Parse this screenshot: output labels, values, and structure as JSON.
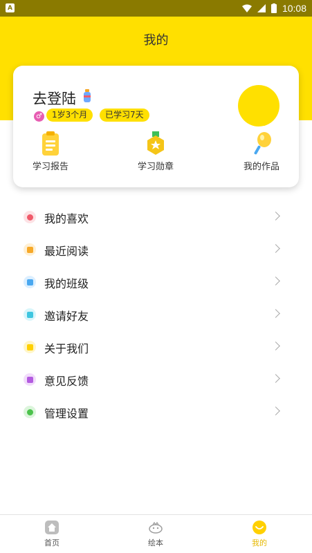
{
  "status_bar": {
    "left_glyph": "A",
    "time": "10:08"
  },
  "header": {
    "title": "我的"
  },
  "profile": {
    "username": "去登陆",
    "gender_glyph": "♂",
    "age_badge": "1岁3个月",
    "study_badge": "已学习7天"
  },
  "card_actions": [
    {
      "label": "学习报告",
      "icon": "clipboard-report-icon"
    },
    {
      "label": "学习勋章",
      "icon": "medal-icon"
    },
    {
      "label": "我的作品",
      "icon": "lollipop-works-icon"
    }
  ],
  "menu": [
    {
      "label": "我的喜欢",
      "icon": "heart-icon",
      "color": "#f05a6a",
      "bg": "#fde2e5"
    },
    {
      "label": "最近阅读",
      "icon": "book-icon",
      "color": "#f7a928",
      "bg": "#fff0d4"
    },
    {
      "label": "我的班级",
      "icon": "house-icon",
      "color": "#4aa8f0",
      "bg": "#dcefff"
    },
    {
      "label": "邀请好友",
      "icon": "invite-icon",
      "color": "#3ec6e0",
      "bg": "#d9f6fb"
    },
    {
      "label": "关于我们",
      "icon": "about-icon",
      "color": "#ffd000",
      "bg": "#fff6c8"
    },
    {
      "label": "意见反馈",
      "icon": "feedback-icon",
      "color": "#b35be0",
      "bg": "#f2ddfb"
    },
    {
      "label": "管理设置",
      "icon": "settings-icon",
      "color": "#4cc24c",
      "bg": "#dcf5dc"
    }
  ],
  "tabbar": {
    "items": [
      {
        "label": "首页",
        "icon": "home-icon"
      },
      {
        "label": "绘本",
        "icon": "picture-book-icon"
      },
      {
        "label": "我的",
        "icon": "smile-icon",
        "active": true
      }
    ],
    "active_color": "#e6b800"
  },
  "colors": {
    "brand_yellow": "#ffe000"
  }
}
